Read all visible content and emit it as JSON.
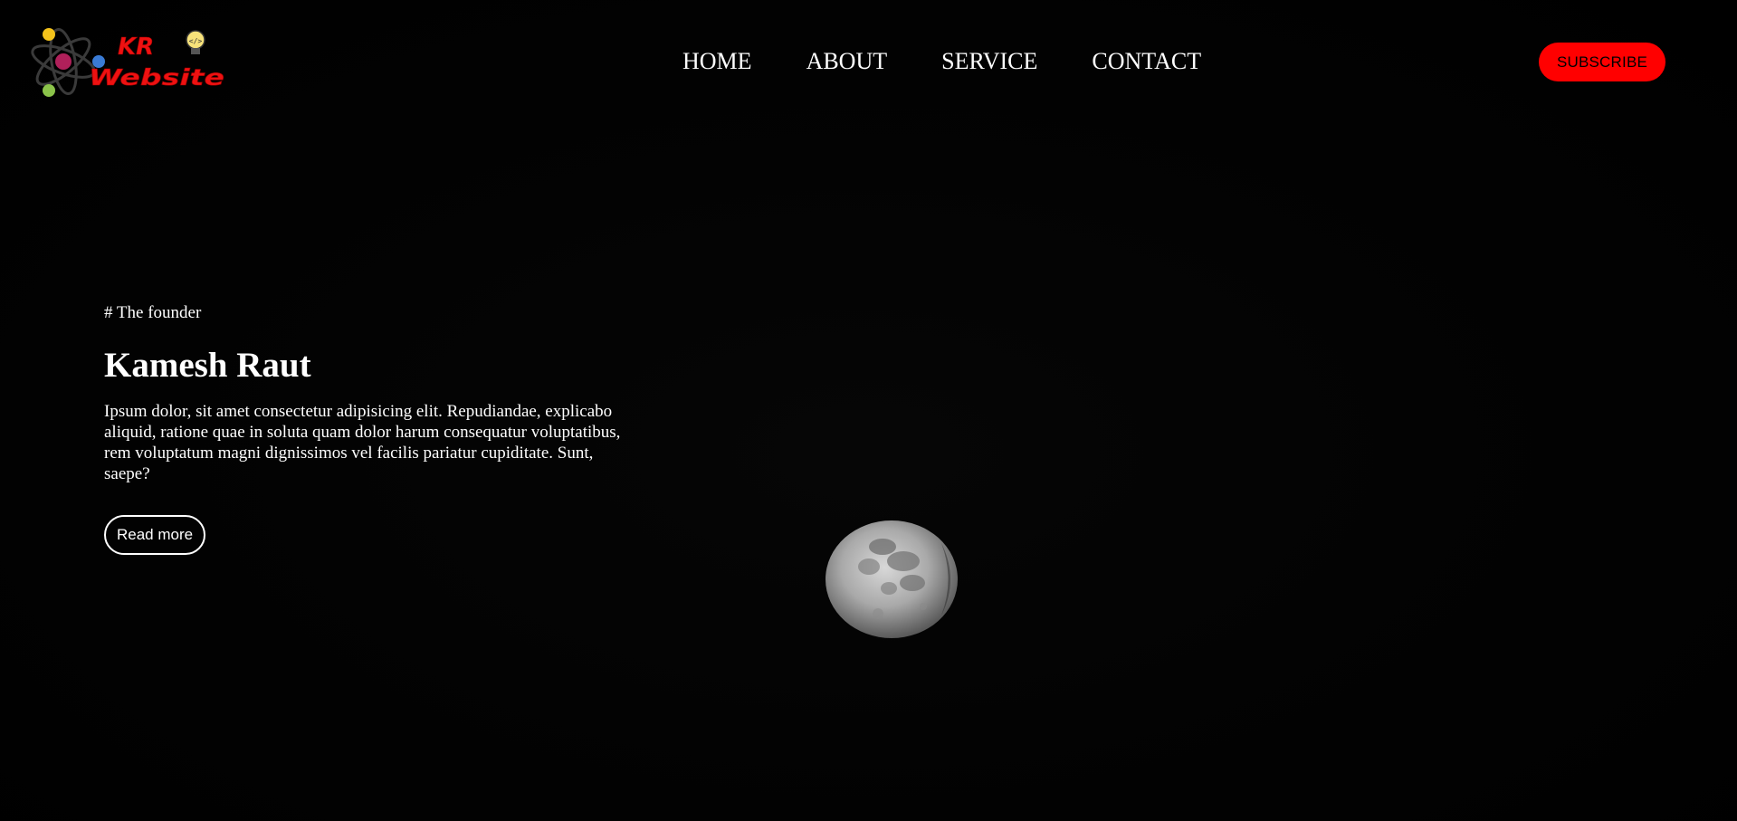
{
  "header": {
    "logo": {
      "line1": "KR",
      "line2": "Website",
      "icon": "atom-bulb-logo"
    },
    "nav": [
      {
        "label": "HOME"
      },
      {
        "label": "ABOUT"
      },
      {
        "label": "SERVICE"
      },
      {
        "label": "CONTACT"
      }
    ],
    "subscribe_label": "SUBSCRIBE"
  },
  "hero": {
    "eyebrow": "# The founder",
    "title": "Kamesh Raut",
    "description": "Ipsum dolor, sit amet consectetur adipisicing elit. Repudiandae, explicabo aliquid, ratione quae in soluta quam dolor harum consequatur voluptatibus, rem voluptatum magni dignissimos vel facilis pariatur cupiditate. Sunt, saepe?",
    "read_more_label": "Read more"
  },
  "background": {
    "image": "moon-icon"
  },
  "colors": {
    "background": "#000000",
    "accent": "#ff0000",
    "text": "#ffffff"
  }
}
